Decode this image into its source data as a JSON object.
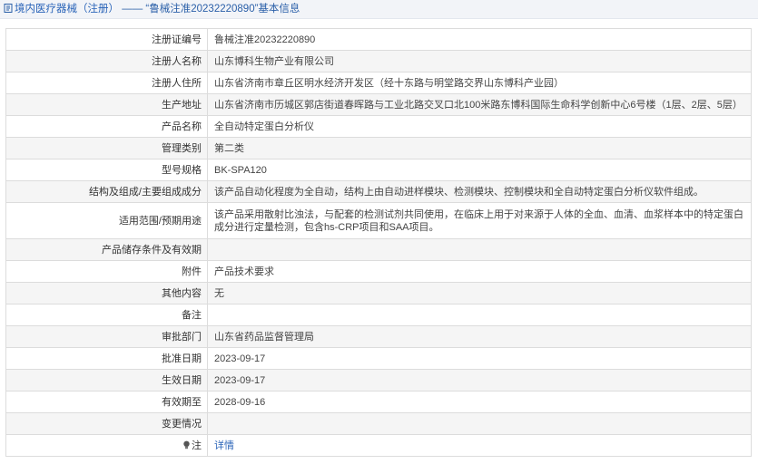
{
  "header": {
    "breadcrumb_link": "境内医疗器械（注册）",
    "separator": "——",
    "record_title": "“鲁械注准20232220890”基本信息"
  },
  "rows": [
    {
      "label": "注册证编号",
      "value": "鲁械注准20232220890"
    },
    {
      "label": "注册人名称",
      "value": "山东博科生物产业有限公司"
    },
    {
      "label": "注册人住所",
      "value": "山东省济南市章丘区明水经济开发区（经十东路与明堂路交界山东博科产业园）"
    },
    {
      "label": "生产地址",
      "value": "山东省济南市历城区郭店街道春晖路与工业北路交叉口北100米路东博科国际生命科学创新中心6号楼（1层、2层、5层）"
    },
    {
      "label": "产品名称",
      "value": "全自动特定蛋白分析仪"
    },
    {
      "label": "管理类别",
      "value": "第二类"
    },
    {
      "label": "型号规格",
      "value": "BK-SPA120"
    },
    {
      "label": "结构及组成/主要组成成分",
      "value": "该产品自动化程度为全自动，结构上由自动进样模块、检测模块、控制模块和全自动特定蛋白分析仪软件组成。"
    },
    {
      "label": "适用范围/预期用途",
      "value": "该产品采用散射比浊法，与配套的检测试剂共同使用，在临床上用于对来源于人体的全血、血清、血浆样本中的特定蛋白成分进行定量检测，包含hs-CRP项目和SAA项目。"
    },
    {
      "label": "产品储存条件及有效期",
      "value": ""
    },
    {
      "label": "附件",
      "value": "产品技术要求"
    },
    {
      "label": "其他内容",
      "value": "无"
    },
    {
      "label": "备注",
      "value": ""
    },
    {
      "label": "审批部门",
      "value": "山东省药品监督管理局"
    },
    {
      "label": "批准日期",
      "value": "2023-09-17"
    },
    {
      "label": "生效日期",
      "value": "2023-09-17"
    },
    {
      "label": "有效期至",
      "value": "2028-09-16"
    },
    {
      "label": "变更情况",
      "value": ""
    },
    {
      "label": "注",
      "value": "详情"
    }
  ],
  "colors": {
    "link": "#2a64b8",
    "title": "#2a5fa8",
    "header_bg": "#f2f4f8",
    "stripe": "#f5f5f5",
    "border": "#dcdcdc"
  },
  "icons": {
    "title": "document-icon",
    "note": "lightbulb-icon"
  }
}
